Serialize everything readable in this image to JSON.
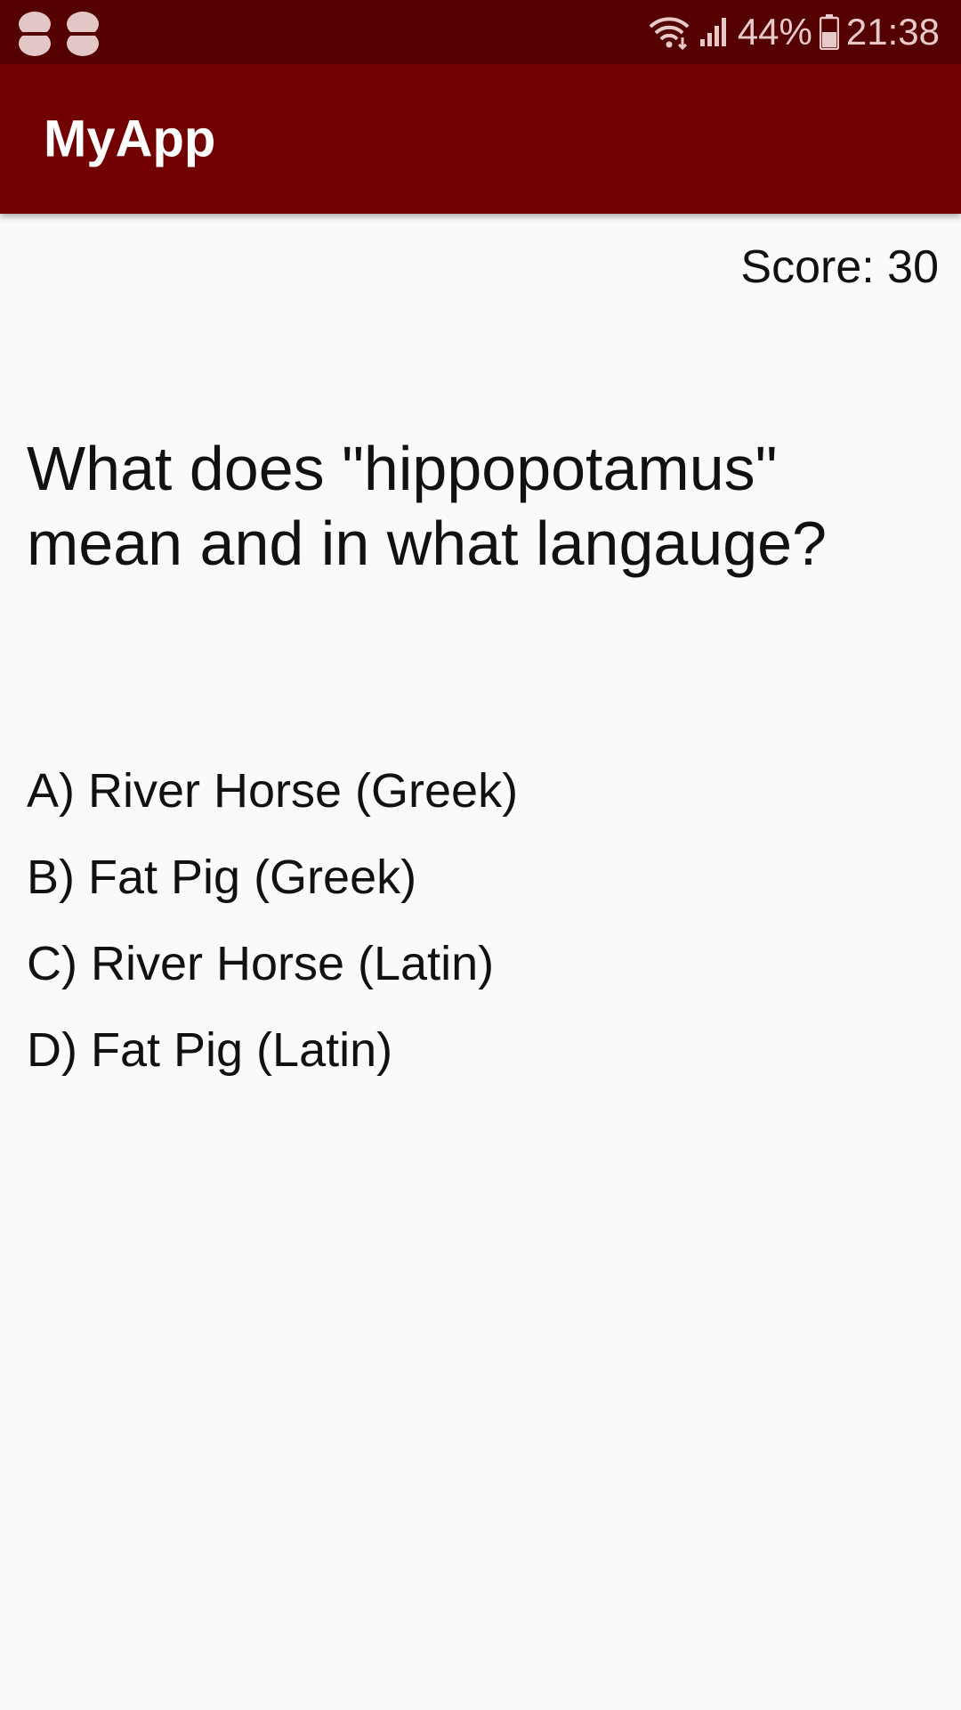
{
  "status_bar": {
    "notification_icons": [
      "notification-icon",
      "notification-icon"
    ],
    "wifi_icon": "wifi-icon",
    "signal_icon": "signal-icon",
    "battery_percent": "44%",
    "battery_icon": "battery-icon",
    "time": "21:38"
  },
  "app_bar": {
    "title": "MyApp"
  },
  "quiz": {
    "score": "Score: 30",
    "question": "What does \"hippopotamus\" mean and in what langauge?",
    "answers": [
      {
        "label": "A) River Horse (Greek)"
      },
      {
        "label": "B) Fat Pig (Greek)"
      },
      {
        "label": "C) River Horse (Latin)"
      },
      {
        "label": "D) Fat Pig (Latin)"
      }
    ]
  },
  "colors": {
    "status_bar": "#550000",
    "app_bar": "#730000",
    "background": "#FAFAFA",
    "text": "#111111"
  }
}
